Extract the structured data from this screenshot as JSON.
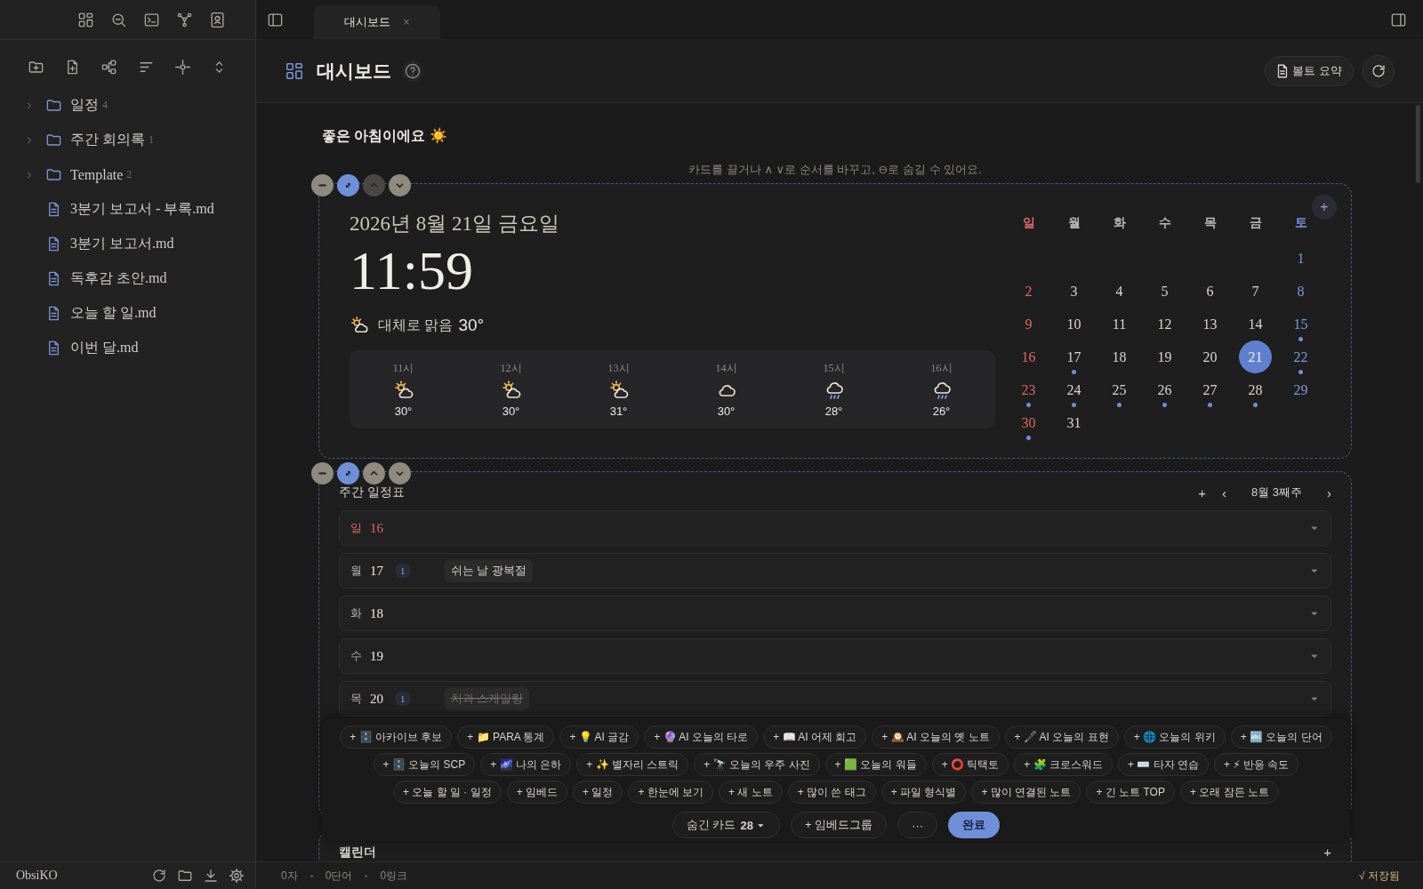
{
  "sidebar": {
    "tree": [
      {
        "kind": "folder",
        "name": "일정",
        "count": "4"
      },
      {
        "kind": "folder",
        "name": "주간 회의록",
        "count": "1"
      },
      {
        "kind": "folder",
        "name": "Template",
        "count": "2"
      },
      {
        "kind": "file",
        "name": "3분기 보고서 - 부록.md"
      },
      {
        "kind": "file",
        "name": "3분기 보고서.md"
      },
      {
        "kind": "file",
        "name": "독후감 초안.md"
      },
      {
        "kind": "file",
        "name": "오늘 할 일.md"
      },
      {
        "kind": "file",
        "name": "이번 달.md"
      }
    ],
    "app_name": "ObsiKO"
  },
  "tabs": [
    {
      "label": "대시보드",
      "selected": true,
      "close": "×"
    }
  ],
  "header": {
    "title": "대시보드",
    "button": "볼트 요약"
  },
  "greeting": "좋은 아침이에요 ☀️",
  "hint": "카드를 끌거나 ∧ ∨로 순서를 바꾸고, ⊖로 숨길 수 있어요.",
  "clock_card": {
    "move_up_disabled": true,
    "date": "2026년 8월 21일 금요일",
    "time": "11:59",
    "weather": {
      "kind": "partly_sunny",
      "condition": "대체로 맑음",
      "temp": "30°"
    },
    "hourly": [
      {
        "hour": "11시",
        "kind": "partly_sunny",
        "temp": "30°"
      },
      {
        "hour": "12시",
        "kind": "partly_sunny",
        "temp": "30°"
      },
      {
        "hour": "13시",
        "kind": "partly_sunny",
        "temp": "31°"
      },
      {
        "hour": "14시",
        "kind": "cloudy",
        "temp": "30°"
      },
      {
        "hour": "15시",
        "kind": "rain",
        "temp": "28°"
      },
      {
        "hour": "16시",
        "kind": "rain",
        "temp": "26°"
      }
    ],
    "calendar": {
      "add": "+",
      "weekdays": [
        "일",
        "월",
        "화",
        "수",
        "목",
        "금",
        "토"
      ],
      "weeks": [
        {
          "kind": "leading",
          "days": [
            {
              "day": "1",
              "event": false,
              "selected": false
            }
          ]
        },
        {
          "kind": "full",
          "days": [
            {
              "day": "2",
              "event": false,
              "selected": false
            },
            {
              "day": "3",
              "event": false,
              "selected": false
            },
            {
              "day": "4",
              "event": false,
              "selected": false
            },
            {
              "day": "5",
              "event": false,
              "selected": false
            },
            {
              "day": "6",
              "event": false,
              "selected": false
            },
            {
              "day": "7",
              "event": false,
              "selected": false
            },
            {
              "day": "8",
              "event": false,
              "selected": false
            }
          ]
        },
        {
          "kind": "full",
          "days": [
            {
              "day": "9",
              "event": false,
              "selected": false
            },
            {
              "day": "10",
              "event": false,
              "selected": false
            },
            {
              "day": "11",
              "event": false,
              "selected": false
            },
            {
              "day": "12",
              "event": false,
              "selected": false
            },
            {
              "day": "13",
              "event": false,
              "selected": false
            },
            {
              "day": "14",
              "event": false,
              "selected": false
            },
            {
              "day": "15",
              "event": true,
              "selected": false
            }
          ]
        },
        {
          "kind": "full",
          "days": [
            {
              "day": "16",
              "event": false,
              "selected": false
            },
            {
              "day": "17",
              "event": true,
              "selected": false
            },
            {
              "day": "18",
              "event": false,
              "selected": false
            },
            {
              "day": "19",
              "event": false,
              "selected": false
            },
            {
              "day": "20",
              "event": false,
              "selected": false
            },
            {
              "day": "21",
              "event": false,
              "selected": true
            },
            {
              "day": "22",
              "event": true,
              "selected": false
            }
          ]
        },
        {
          "kind": "full",
          "days": [
            {
              "day": "23",
              "event": true,
              "selected": false
            },
            {
              "day": "24",
              "event": true,
              "selected": false
            },
            {
              "day": "25",
              "event": true,
              "selected": false
            },
            {
              "day": "26",
              "event": true,
              "selected": false
            },
            {
              "day": "27",
              "event": true,
              "selected": false
            },
            {
              "day": "28",
              "event": true,
              "selected": false
            },
            {
              "day": "29",
              "event": false,
              "selected": false
            }
          ]
        },
        {
          "kind": "trailing",
          "days": [
            {
              "day": "30",
              "event": true,
              "selected": false
            },
            {
              "day": "31",
              "event": false,
              "selected": false
            }
          ]
        }
      ]
    }
  },
  "weekly_card": {
    "move_up_disabled": false,
    "title": "주간 일정표",
    "add": "+",
    "prev": "‹",
    "period": "8월 3째주",
    "next": "›",
    "days": [
      {
        "weekday": "일",
        "day": "16"
      },
      {
        "weekday": "월",
        "day": "17",
        "count": "1",
        "event": {
          "title": "쉬는 날 광복절",
          "done": false
        }
      },
      {
        "weekday": "화",
        "day": "18"
      },
      {
        "weekday": "수",
        "day": "19"
      },
      {
        "weekday": "목",
        "day": "20",
        "count": "1",
        "event": {
          "title": "치과 스케일링",
          "done": true
        }
      }
    ]
  },
  "card_picker": {
    "chip_rows": [
      [
        "+ 🗄️ 아카이브 후보",
        "+ 📁 PARA 통계",
        "+ 💡 AI 글감",
        "+ 🔮 AI 오늘의 타로",
        "+ 📖 AI 어제 회고",
        "+ 🕰️ AI 오늘의 옛 노트",
        "+ 🖋️ AI 오늘의 표현",
        "+ 🌐 오늘의 위키",
        "+ 🔤 오늘의 단어"
      ],
      [
        "+ 🗄️ 오늘의 SCP",
        "+ 🌌 나의 은하",
        "+ ✨ 별자리 스트릭",
        "+ 🔭 오늘의 우주 사진",
        "+ 🟩 오늘의 워들",
        "+ ⭕ 틱택토",
        "+ 🧩 크로스워드",
        "+ ⌨️ 타자 연습",
        "+ ⚡ 반응 속도"
      ],
      [
        "+ 오늘 할 일 · 일정",
        "+ 임베드",
        "+ 일정",
        "+ 한눈에 보기",
        "+ 새 노트",
        "+ 많이 쓴 태그",
        "+ 파일 형식별",
        "+ 많이 연결된 노트",
        "+ 긴 노트 TOP",
        "+ 오래 잠든 노트"
      ]
    ],
    "hidden_label": "숨긴 카드",
    "hidden_count": "28",
    "embed_group": "+ 임베드그룹",
    "more": "···",
    "done": "완료"
  },
  "calendar_card": {
    "title": "캘린더",
    "add": "+"
  },
  "status_bar": {
    "chars": "0자",
    "words": "0단어",
    "links": "0링크",
    "saved": "√ 저장됨"
  }
}
